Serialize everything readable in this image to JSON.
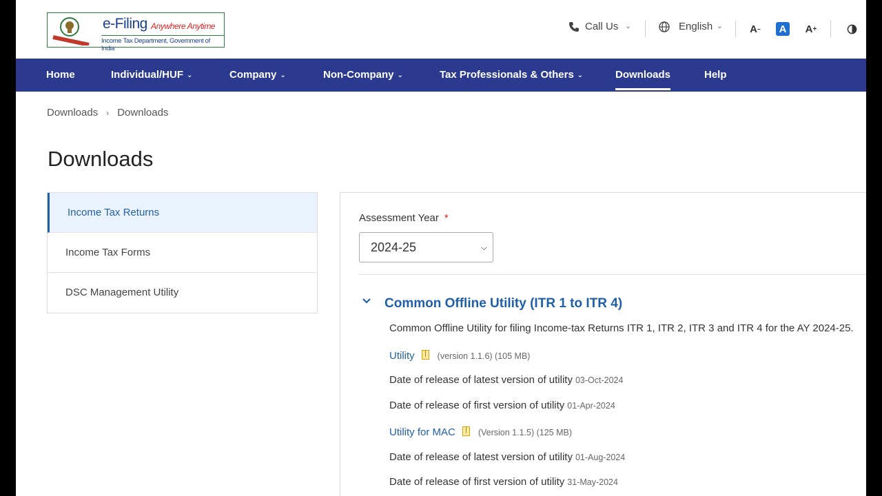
{
  "header": {
    "logo_title": "e-Filing",
    "logo_tagline": "Anywhere Anytime",
    "logo_subtitle": "Income Tax Department, Government of India",
    "call_us": "Call Us",
    "language": "English",
    "font_decrease": "A",
    "font_normal": "A",
    "font_increase": "A"
  },
  "nav": {
    "items": [
      {
        "label": "Home"
      },
      {
        "label": "Individual/HUF"
      },
      {
        "label": "Company"
      },
      {
        "label": "Non-Company"
      },
      {
        "label": "Tax Professionals & Others"
      },
      {
        "label": "Downloads"
      },
      {
        "label": "Help"
      }
    ],
    "chevron": "⌄"
  },
  "breadcrumb": {
    "items": [
      "Downloads",
      "Downloads"
    ],
    "separator": "›"
  },
  "page_title": "Downloads",
  "sidebar": {
    "items": [
      {
        "label": "Income Tax Returns"
      },
      {
        "label": "Income Tax Forms"
      },
      {
        "label": "DSC Management Utility"
      }
    ]
  },
  "content": {
    "assessment_year_label": "Assessment Year",
    "required_mark": "*",
    "assessment_year_value": "2024-25",
    "section": {
      "title": "Common Offline Utility (ITR 1 to ITR 4)",
      "description": "Common Offline Utility for filing Income-tax Returns ITR 1, ITR 2, ITR 3 and ITR 4 for the AY 2024-25.",
      "utility_link": "Utility",
      "utility_meta": "(version 1.1.6) (105 MB)",
      "latest_release_label": "Date of release of latest version of utility",
      "latest_release_date": "03-Oct-2024",
      "first_release_label": "Date of release of first version of utility",
      "first_release_date": "01-Apr-2024",
      "mac_link": "Utility for MAC",
      "mac_meta": "(Version 1.1.5) (125 MB)",
      "mac_latest_label": "Date of release of latest version of utility",
      "mac_latest_date": "01-Aug-2024",
      "mac_first_label": "Date of release of first version of utility",
      "mac_first_date": "31-May-2024"
    }
  },
  "colors": {
    "nav_bg": "#2b3a8f",
    "link_blue": "#1f5fa8",
    "required_red": "#dd2222"
  }
}
